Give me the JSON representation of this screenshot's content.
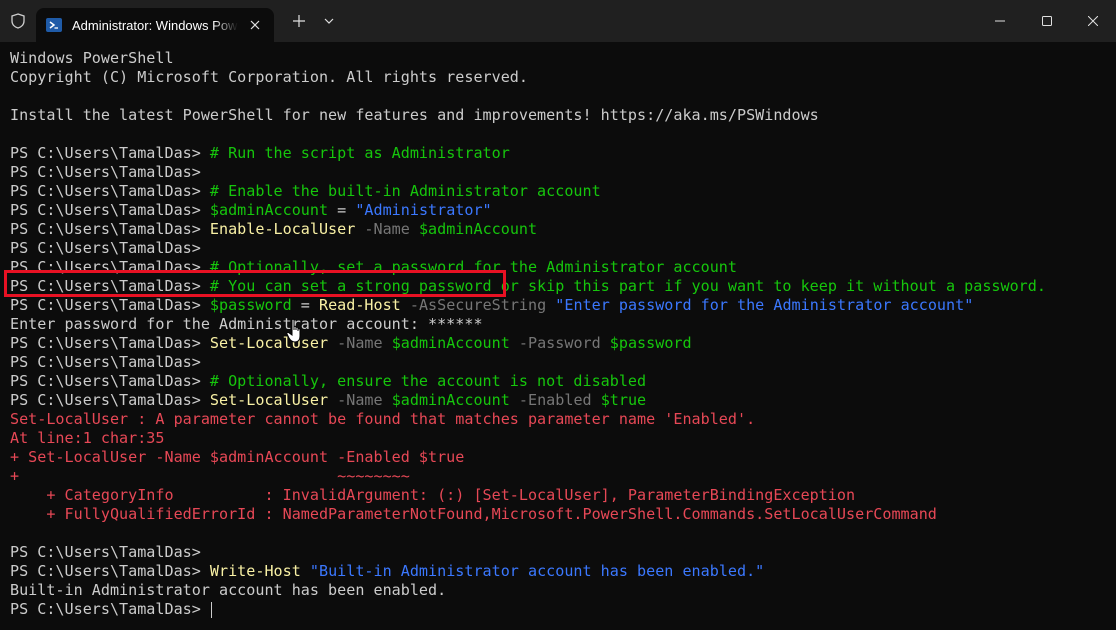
{
  "window": {
    "tab_title": "Administrator: Windows PowerShell",
    "new_tab_symbol": "+",
    "icons": {
      "shield": "shield-icon",
      "tab": "powershell-icon",
      "tab_close": "close-icon",
      "dropdown": "chevron-down-icon",
      "minimize": "minimize-icon",
      "maximize": "maximize-icon",
      "close": "close-icon"
    }
  },
  "colors": {
    "background": "#0c0c0c",
    "text": "#cccccc",
    "comment": "#16c60c",
    "string": "#3b78ff",
    "command": "#f9f1a5",
    "parameter": "#767676",
    "variable": "#16c60c",
    "error": "#e74856",
    "highlight_box": "#e81123"
  },
  "terminal": {
    "lines": [
      [
        {
          "t": "Windows PowerShell",
          "c": "txt"
        }
      ],
      [
        {
          "t": "Copyright (C) Microsoft Corporation. All rights reserved.",
          "c": "txt"
        }
      ],
      [],
      [
        {
          "t": "Install the latest PowerShell for new features and improvements! https://aka.ms/PSWindows",
          "c": "txt"
        }
      ],
      [],
      [
        {
          "t": "PS C:\\Users\\TamalDas> ",
          "c": "txt"
        },
        {
          "t": "# Run the script as Administrator",
          "c": "com"
        }
      ],
      [
        {
          "t": "PS C:\\Users\\TamalDas>",
          "c": "txt"
        }
      ],
      [
        {
          "t": "PS C:\\Users\\TamalDas> ",
          "c": "txt"
        },
        {
          "t": "# Enable the built-in Administrator account",
          "c": "com"
        }
      ],
      [
        {
          "t": "PS C:\\Users\\TamalDas> ",
          "c": "txt"
        },
        {
          "t": "$adminAccount",
          "c": "var"
        },
        {
          "t": " = ",
          "c": "txt"
        },
        {
          "t": "\"Administrator\"",
          "c": "str"
        }
      ],
      [
        {
          "t": "PS C:\\Users\\TamalDas> ",
          "c": "txt"
        },
        {
          "t": "Enable-LocalUser",
          "c": "cmd"
        },
        {
          "t": " -Name ",
          "c": "par"
        },
        {
          "t": "$adminAccount",
          "c": "var"
        }
      ],
      [
        {
          "t": "PS C:\\Users\\TamalDas>",
          "c": "txt"
        }
      ],
      [
        {
          "t": "PS C:\\Users\\TamalDas> ",
          "c": "txt"
        },
        {
          "t": "# Optionally, set a password for the Administrator account",
          "c": "com"
        }
      ],
      [
        {
          "t": "PS C:\\Users\\TamalDas> ",
          "c": "txt"
        },
        {
          "t": "# You can set a strong password or skip this part if you want to keep it without a password.",
          "c": "com"
        }
      ],
      [
        {
          "t": "PS C:\\Users\\TamalDas> ",
          "c": "txt"
        },
        {
          "t": "$password",
          "c": "var"
        },
        {
          "t": " = ",
          "c": "txt"
        },
        {
          "t": "Read-Host",
          "c": "cmd"
        },
        {
          "t": " -AsSecureString ",
          "c": "par"
        },
        {
          "t": "\"Enter password for the Administrator account\"",
          "c": "str"
        }
      ],
      [
        {
          "t": "Enter password for the Administrator account: ******",
          "c": "txt"
        }
      ],
      [
        {
          "t": "PS C:\\Users\\TamalDas> ",
          "c": "txt"
        },
        {
          "t": "Set-LocalUser",
          "c": "cmd"
        },
        {
          "t": " -Name ",
          "c": "par"
        },
        {
          "t": "$adminAccount",
          "c": "var"
        },
        {
          "t": " -Password ",
          "c": "par"
        },
        {
          "t": "$password",
          "c": "var"
        }
      ],
      [
        {
          "t": "PS C:\\Users\\TamalDas>",
          "c": "txt"
        }
      ],
      [
        {
          "t": "PS C:\\Users\\TamalDas> ",
          "c": "txt"
        },
        {
          "t": "# Optionally, ensure the account is not disabled",
          "c": "com"
        }
      ],
      [
        {
          "t": "PS C:\\Users\\TamalDas> ",
          "c": "txt"
        },
        {
          "t": "Set-LocalUser",
          "c": "cmd"
        },
        {
          "t": " -Name ",
          "c": "par"
        },
        {
          "t": "$adminAccount",
          "c": "var"
        },
        {
          "t": " -Enabled ",
          "c": "par"
        },
        {
          "t": "$true",
          "c": "var"
        }
      ],
      [
        {
          "t": "Set-LocalUser : A parameter cannot be found that matches parameter name 'Enabled'.",
          "c": "err"
        }
      ],
      [
        {
          "t": "At line:1 char:35",
          "c": "err"
        }
      ],
      [
        {
          "t": "+ Set-LocalUser -Name $adminAccount -Enabled $true",
          "c": "err"
        }
      ],
      [
        {
          "t": "+                                   ~~~~~~~~",
          "c": "err"
        }
      ],
      [
        {
          "t": "    + CategoryInfo          : InvalidArgument: (:) [Set-LocalUser], ParameterBindingException",
          "c": "err"
        }
      ],
      [
        {
          "t": "    + FullyQualifiedErrorId : NamedParameterNotFound,Microsoft.PowerShell.Commands.SetLocalUserCommand",
          "c": "err"
        }
      ],
      [],
      [
        {
          "t": "PS C:\\Users\\TamalDas>",
          "c": "txt"
        }
      ],
      [
        {
          "t": "PS C:\\Users\\TamalDas> ",
          "c": "txt"
        },
        {
          "t": "Write-Host",
          "c": "cmd"
        },
        {
          "t": " ",
          "c": "txt"
        },
        {
          "t": "\"Built-in Administrator account has been enabled.\"",
          "c": "str"
        }
      ],
      [
        {
          "t": "Built-in Administrator account has been enabled.",
          "c": "txt"
        }
      ],
      [
        {
          "t": "PS C:\\Users\\TamalDas> ",
          "c": "txt"
        }
      ]
    ]
  }
}
